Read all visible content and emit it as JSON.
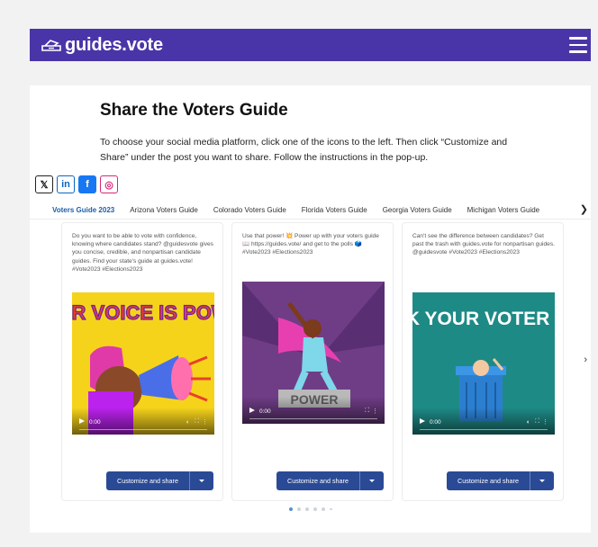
{
  "header": {
    "brand": "guides.vote",
    "menu_icon": "hamburger-icon",
    "bar_color": "#4a35a8"
  },
  "page": {
    "title": "Share the Voters Guide",
    "intro": "To choose your social media platform, click one of the icons to the left. Then click “Customize and Share” under the post you want to share. Follow the instructions in the pop-up."
  },
  "social": [
    {
      "name": "x",
      "glyph": "𝕏"
    },
    {
      "name": "linkedin",
      "glyph": "in"
    },
    {
      "name": "facebook",
      "glyph": "f"
    },
    {
      "name": "instagram",
      "glyph": "◎"
    }
  ],
  "tabs": [
    "Voters Guide 2023",
    "Arizona Voters Guide",
    "Colorado Voters Guide",
    "Florida Voters Guide",
    "Georgia Voters Guide",
    "Michigan Voters Guide"
  ],
  "tab_next": "❯",
  "posts": [
    {
      "text": "Do you want to be able to vote with confidence, knowing where candidates stand? @guidesvote gives you concise, credible, and nonpartisan candidate guides. Find your state's guide at guides.vote! #Vote2023 #Elections2023",
      "image_text": "YOUR VOICE IS POWER",
      "time": "0:00",
      "button": "Customize and share"
    },
    {
      "text": "Use that power! 💥 Power up with your voters guide 📖 https://guides.vote/ and get to the polls 🗳️ #Vote2023 #Elections2023",
      "image_text": "POWER",
      "time": "0:00",
      "button": "Customize and share"
    },
    {
      "text": "Can't see the difference between candidates? Get past the trash with guides.vote for nonpartisan guides. @guidesvote #Vote2023 #Elections2023",
      "image_text": "CHECK YOUR VOTER GUIDE",
      "time": "0:00",
      "button": "Customize and share"
    }
  ],
  "carousel_next": "›"
}
